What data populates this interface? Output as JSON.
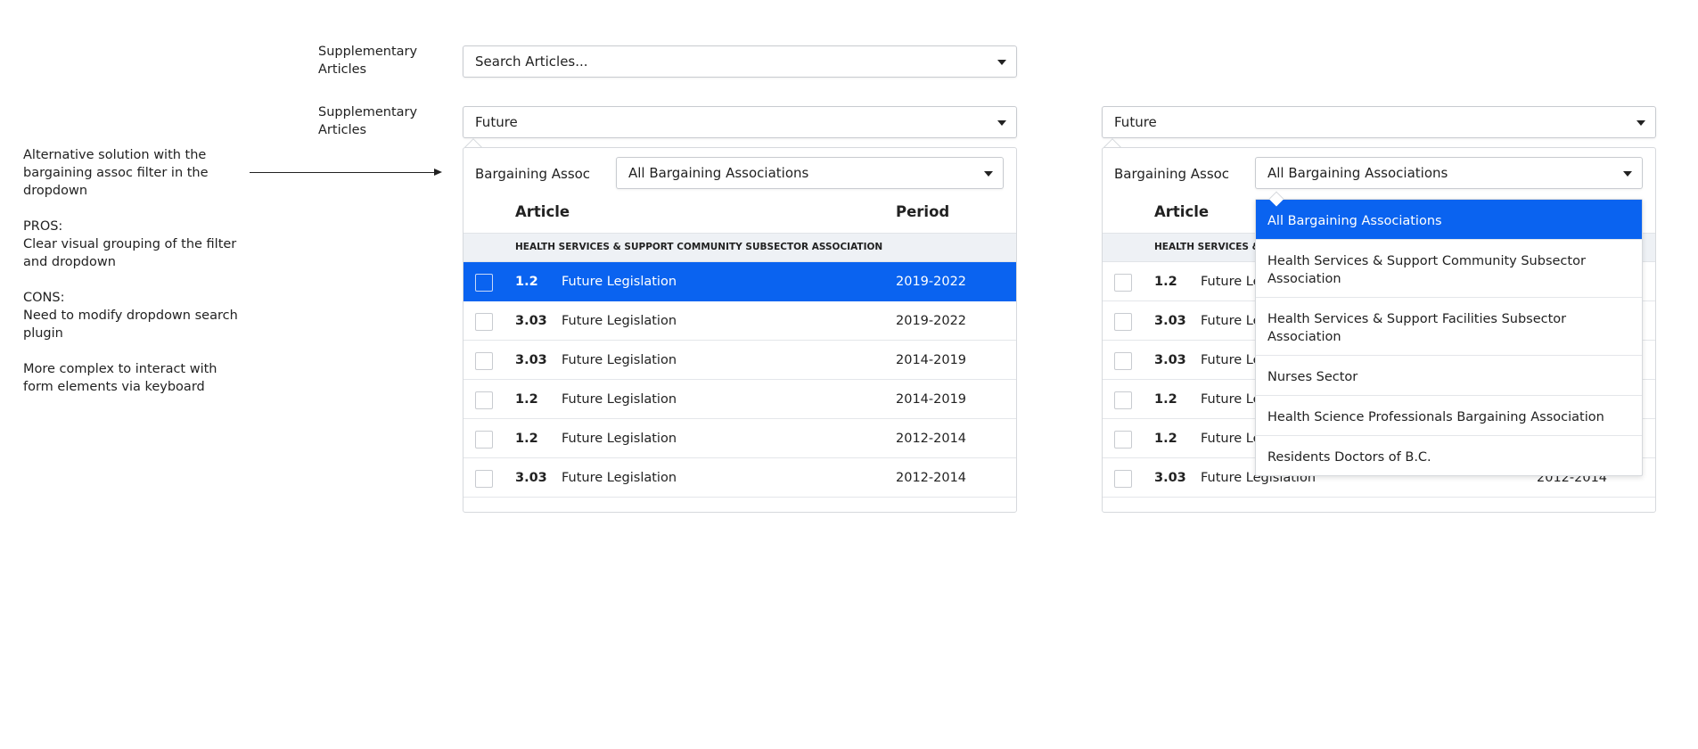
{
  "notes": {
    "intro": "Alternative solution with the bargaining assoc filter in the dropdown",
    "pros_title": "PROS:",
    "pros_text": "Clear visual grouping of the filter and dropdown",
    "cons_title": "CONS:",
    "cons_text_1": "Need to modify dropdown search plugin",
    "cons_text_2": "More complex to interact with form elements via keyboard"
  },
  "labels": {
    "supplementary_1": "Supplementary Articles",
    "supplementary_2": "Supplementary Articles"
  },
  "search_select": {
    "placeholder": "Search Articles..."
  },
  "future_select": {
    "value": "Future"
  },
  "filter": {
    "label": "Bargaining Assoc",
    "value": "All Bargaining Associations"
  },
  "table": {
    "col_article": "Article",
    "col_period": "Period",
    "group": "HEALTH SERVICES & SUPPORT COMMUNITY SUBSECTOR ASSOCIATION",
    "group_truncated": "HEALTH SERVICES & S",
    "rows": [
      {
        "num": "1.2",
        "title": "Future Legislation",
        "title_truncated": "Future Le",
        "period": "2019-2022"
      },
      {
        "num": "3.03",
        "title": "Future Legislation",
        "title_truncated": "Future Le",
        "period": "2019-2022"
      },
      {
        "num": "3.03",
        "title": "Future Legislation",
        "title_truncated": "Future Le",
        "period": "2014-2019"
      },
      {
        "num": "1.2",
        "title": "Future Legislation",
        "title_truncated": "Future Le",
        "period": "2014-2019"
      },
      {
        "num": "1.2",
        "title": "Future Legislation",
        "title_truncated": "Future Le",
        "period": "2012-2014"
      },
      {
        "num": "3.03",
        "title": "Future Legislation",
        "title_truncated": "Future Legislation",
        "period": "2012-2014"
      }
    ]
  },
  "assoc_options": [
    "All Bargaining Associations",
    "Health Services & Support Community Subsector Association",
    "Health Services & Support Facilities Subsector Association",
    "Nurses Sector",
    "Health Science Professionals Bargaining Association",
    "Residents Doctors of B.C."
  ],
  "colors": {
    "accent": "#0a63f0",
    "group_bg": "#eef1f5",
    "border": "#d6d9dd"
  }
}
